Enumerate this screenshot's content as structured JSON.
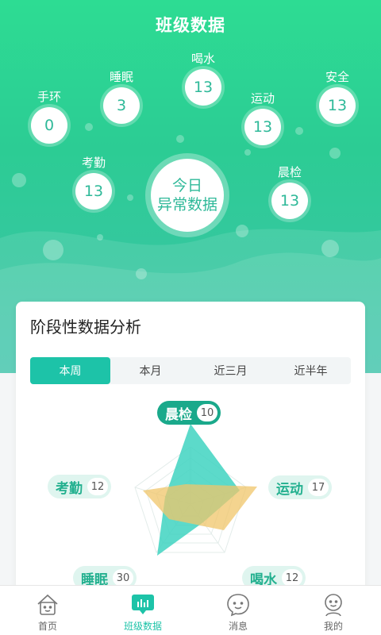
{
  "header": {
    "title": "班级数据"
  },
  "bubbles": [
    {
      "label": "手环",
      "value": "0"
    },
    {
      "label": "睡眠",
      "value": "3"
    },
    {
      "label": "喝水",
      "value": "13"
    },
    {
      "label": "运动",
      "value": "13"
    },
    {
      "label": "安全",
      "value": "13"
    },
    {
      "label": "考勤",
      "value": "13"
    },
    {
      "label": "晨检",
      "value": "13"
    }
  ],
  "center": {
    "line1": "今日",
    "line2": "异常数据"
  },
  "analysis": {
    "title": "阶段性数据分析",
    "tabs": [
      "本周",
      "本月",
      "近三月",
      "近半年"
    ],
    "active_tab": "本周",
    "radar_tags": [
      {
        "label": "晨检",
        "value": "10"
      },
      {
        "label": "运动",
        "value": "17"
      },
      {
        "label": "喝水",
        "value": "12"
      },
      {
        "label": "睡眠",
        "value": "30"
      },
      {
        "label": "考勤",
        "value": "12"
      }
    ]
  },
  "tabbar": {
    "items": [
      {
        "label": "首页",
        "icon": "home-icon"
      },
      {
        "label": "班级数据",
        "icon": "chart-icon"
      },
      {
        "label": "消息",
        "icon": "message-icon"
      },
      {
        "label": "我的",
        "icon": "profile-icon"
      }
    ],
    "active": "班级数据"
  },
  "colors": {
    "accent": "#1dc3a8",
    "green_top": "#2ddc93",
    "radar_teal": "#3fd3c1",
    "radar_orange": "#f0c66a"
  }
}
